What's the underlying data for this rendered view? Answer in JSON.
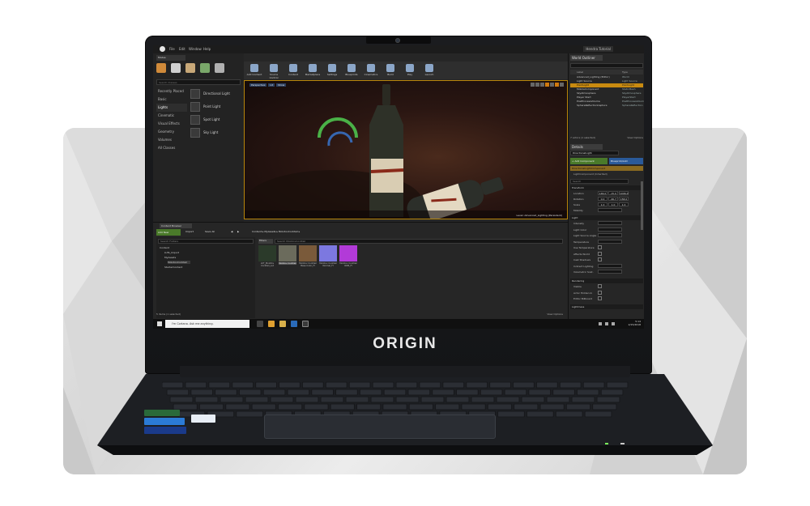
{
  "brand": {
    "logo_text": "ORIGIN"
  },
  "menubar": {
    "items": [
      "File",
      "Edit",
      "Window",
      "Help"
    ],
    "project_name": "Hendra Tutorial"
  },
  "toolbar": {
    "buttons": [
      "Add Content",
      "Source Control",
      "Content",
      "Marketplace",
      "Settings",
      "Blueprints",
      "Cinematics",
      "Build",
      "Play",
      "Launch"
    ]
  },
  "modes": {
    "tab": "Modes",
    "search_placeholder": "Search Classes",
    "categories": [
      "Recently Placed",
      "Basic",
      "Lights",
      "Cinematic",
      "Visual Effects",
      "Geometry",
      "Volumes",
      "All Classes"
    ],
    "active_category": "Lights",
    "lights": [
      "Directional Light",
      "Point Light",
      "Spot Light",
      "Sky Light"
    ]
  },
  "viewport": {
    "buttons": [
      "Perspective",
      "Lit",
      "Show"
    ],
    "caption": "Level: Advanced_Lighting (Persistent)"
  },
  "outliner": {
    "tab": "World Outliner",
    "col_label": "Label",
    "col_type": "Type",
    "rows": [
      {
        "name": "Advanced_Lighting (Editor)",
        "type": "World"
      },
      {
        "name": "Light Source",
        "type": "Light Source"
      },
      {
        "name": "PointLight",
        "type": "PointLight"
      },
      {
        "name": "MobileComponent",
        "type": "StaticMesh"
      },
      {
        "name": "SkyAtmosphere",
        "type": "SkyAtmosphere"
      },
      {
        "name": "Player Start",
        "type": "PlayerStart"
      },
      {
        "name": "PostProcessVolume",
        "type": "PostProcessVolume"
      },
      {
        "name": "SphereReflectionCapture",
        "type": "SphereReflection"
      }
    ],
    "selected_row": 2,
    "footer": "7 actors (1 selected)",
    "view_options": "View Options"
  },
  "details": {
    "tab": "Details",
    "name_value": "DirectionalLight",
    "add_component": "+ Add Component",
    "blueprint": "Blueprint/Add",
    "component": "DirectionalLightComponent",
    "inherited": "LightComponent (Inherited)",
    "search_placeholder": "Search",
    "sections": {
      "transform": "Transform",
      "light": "Light",
      "rendering": "Rendering",
      "lightmass": "Lightmass"
    },
    "transform_labels": [
      "Location",
      "Rotation",
      "Scale",
      "Mobility"
    ],
    "location": [
      "146.0",
      "-15.0",
      "1006.0"
    ],
    "rotation": [
      "0.0",
      "-46.7",
      "158.0"
    ],
    "scale": [
      "1.0",
      "1.0",
      "1.0"
    ],
    "light_labels": [
      "Intensity",
      "Light Color",
      "Light Source Angle",
      "Temperature",
      "Use Temperature",
      "Affects World",
      "Cast Shadows",
      "Indirect Lighting",
      "Volumetric Scat."
    ],
    "rendering_labels": [
      "Visible",
      "Actor Hidden In",
      "Editor Billboard"
    ]
  },
  "content_browser": {
    "tab": "Content Browser",
    "add_new": "Add New",
    "import": "Import",
    "save_all": "Save All",
    "path": [
      "Content",
      "MyAssets",
      "MolotovCocktail"
    ],
    "tree_search": "Search Folders",
    "tree": [
      "Content",
      "LUTs_Import",
      "MyAssets",
      "MolotovCocktail",
      "StarterContent"
    ],
    "tree_selected": 3,
    "filters": "Filters",
    "asset_search": "Search MolotovCocktail",
    "assets": [
      {
        "label": "LUT_Molotov Cocktail_Lut",
        "color": "#2b3a2a"
      },
      {
        "label": "Molotov Cocktail",
        "color": "#6b6b5c"
      },
      {
        "label": "Molotov Cocktail Base Color_FI",
        "color": "#7a5a3a"
      },
      {
        "label": "Molotov Cocktail Normal_FI",
        "color": "#7c78e0"
      },
      {
        "label": "Molotov Cocktail ORM_FI",
        "color": "#b23ad8"
      }
    ],
    "selected_asset": 1,
    "footer": "5 items (1 selected)",
    "view_options": "View Options"
  },
  "taskbar": {
    "search_text": "I'm Cortana. Ask me anything.",
    "time": "5:14",
    "date": "2/15/2018"
  }
}
